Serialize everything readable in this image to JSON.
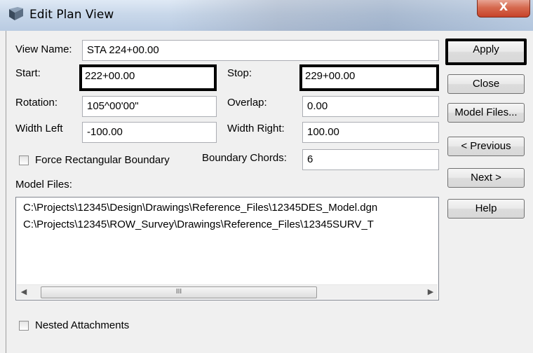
{
  "window": {
    "title": "Edit Plan View",
    "close_glyph": "X"
  },
  "form": {
    "view_name_label": "View Name:",
    "view_name_value": "STA 224+00.00",
    "start_label": "Start:",
    "start_value": "222+00.00",
    "stop_label": "Stop:",
    "stop_value": "229+00.00",
    "rotation_label": "Rotation:",
    "rotation_value": "105^00'00\"",
    "overlap_label": "Overlap:",
    "overlap_value": "0.00",
    "width_left_label": "Width Left",
    "width_left_value": "-100.00",
    "width_right_label": "Width Right:",
    "width_right_value": "100.00",
    "force_rect_label": "Force Rectangular Boundary",
    "force_rect_checked": false,
    "boundary_chords_label": "Boundary Chords:",
    "boundary_chords_value": "6",
    "model_files_label": "Model Files:",
    "model_files": [
      "C:\\Projects\\12345\\Design\\Drawings\\Reference_Files\\12345DES_Model.dgn",
      "C:\\Projects\\12345\\ROW_Survey\\Drawings\\Reference_Files\\12345SURV_T"
    ],
    "scroll_thumb_glyph": "III",
    "nested_label": "Nested Attachments",
    "nested_checked": false
  },
  "buttons": {
    "apply": "Apply",
    "close": "Close",
    "model_files": "Model Files...",
    "previous": "< Previous",
    "next": "Next >",
    "help": "Help"
  }
}
